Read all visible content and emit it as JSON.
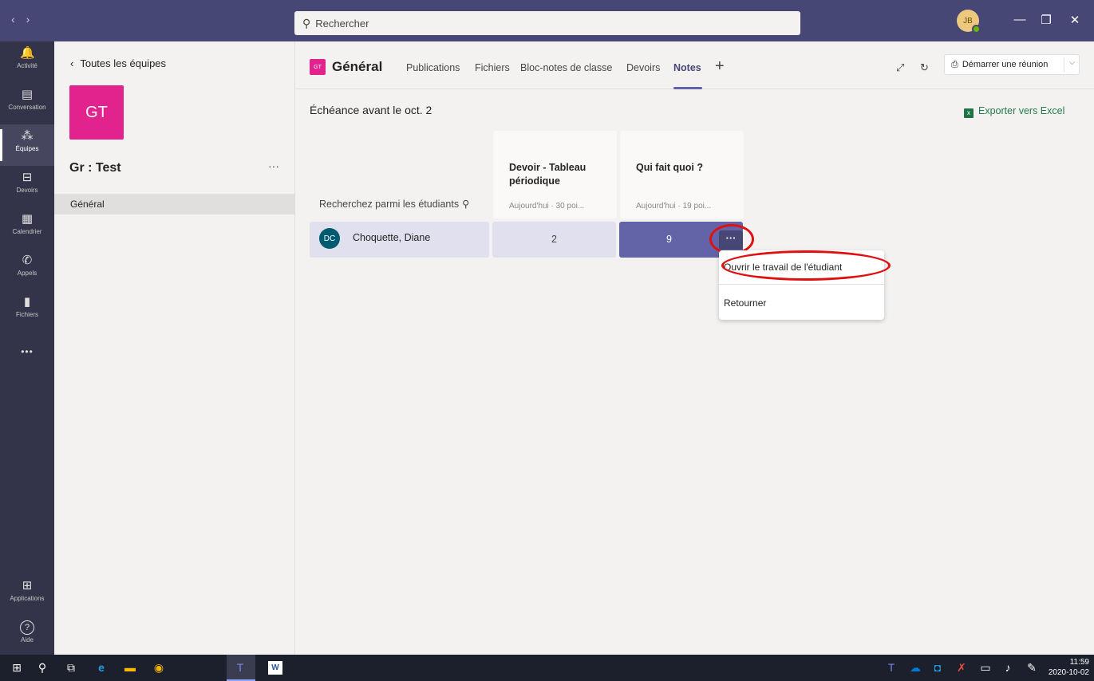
{
  "titlebar": {
    "back_arrow": "‹",
    "forward_arrow": "›",
    "search_placeholder": "Rechercher",
    "user_initials": "JB",
    "minimize": "—",
    "restore": "❐",
    "close": "✕"
  },
  "rail": [
    {
      "label": "Activité",
      "icon": "bell-icon",
      "glyph": "🔔"
    },
    {
      "label": "Conversation",
      "icon": "chat-icon",
      "glyph": "▤"
    },
    {
      "label": "Équipes",
      "icon": "teams-icon",
      "glyph": "⁂",
      "active": true
    },
    {
      "label": "Devoirs",
      "icon": "backpack-icon",
      "glyph": "⊟"
    },
    {
      "label": "Calendrier",
      "icon": "calendar-icon",
      "glyph": "▦"
    },
    {
      "label": "Appels",
      "icon": "phone-icon",
      "glyph": "✆"
    },
    {
      "label": "Fichiers",
      "icon": "file-icon",
      "glyph": "▮"
    },
    {
      "label": "",
      "icon": "more-icon",
      "glyph": "•••"
    }
  ],
  "rail_bottom": [
    {
      "label": "Applications",
      "icon": "apps-icon",
      "glyph": "⊞"
    },
    {
      "label": "Aide",
      "icon": "help-icon",
      "glyph": "?"
    }
  ],
  "team": {
    "back_label": "Toutes les équipes",
    "tile_initials": "GT",
    "name": "Gr : Test",
    "more": "···",
    "channel": "Général"
  },
  "header": {
    "badge": "GT",
    "channel_title": "Général",
    "tabs": [
      "Publications",
      "Fichiers",
      "Bloc-notes de classe",
      "Devoirs",
      "Notes"
    ],
    "active_tab": "Notes",
    "add_tab": "+",
    "meeting_label": "Démarrer une réunion"
  },
  "grades": {
    "due_label": "Échéance avant le oct. 2",
    "export_label": "Exporter vers Excel",
    "student_search_placeholder": "Recherchez parmi les étudiants",
    "assignments": [
      {
        "title": "Devoir - Tableau périodique",
        "meta": "Aujourd'hui · 30 poi..."
      },
      {
        "title": "Qui fait quoi ?",
        "meta": "Aujourd'hui · 19 poi..."
      }
    ],
    "student": {
      "initials": "DC",
      "name": "Choquette, Diane",
      "scores": [
        "2",
        "9"
      ]
    },
    "cell_more": "···",
    "menu": [
      "Ouvrir le travail de l'étudiant",
      "Retourner"
    ]
  },
  "taskbar": {
    "time": "11:59",
    "date": "2020-10-02"
  },
  "colors": {
    "titlebar": "#464775",
    "rail": "#33344a",
    "accent": "#6264a7",
    "team_tile": "#e3238d",
    "highlight_ring": "#e01010"
  }
}
